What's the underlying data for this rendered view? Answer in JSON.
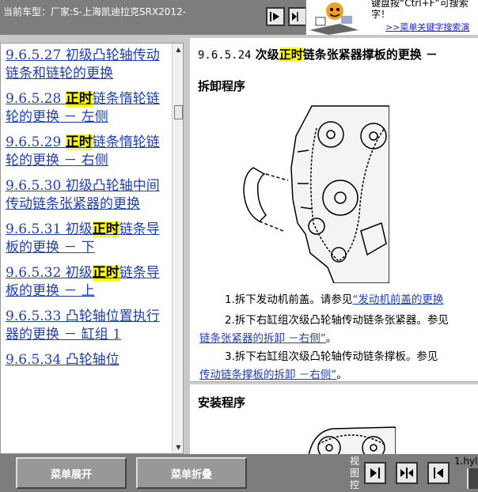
{
  "header": {
    "vehicle_label": "当前车型：厂家:S-上海凯迪拉克SRX2012-",
    "ad": {
      "text": "键盘按“Ctrl+F”可搜索 字！",
      "link": ">>菜单关键字搜索演"
    }
  },
  "menu": {
    "items": [
      {
        "num": "9.6.5.27",
        "pre": " 初级凸轮轴传动链条和链轮的更换",
        "hl": "",
        "post": ""
      },
      {
        "num": "9.6.5.28",
        "pre": " ",
        "hl": "正时",
        "post": "链条惰轮链轮的更换 － 左侧"
      },
      {
        "num": "9.6.5.29",
        "pre": " ",
        "hl": "正时",
        "post": "链条惰轮链轮的更换 － 右侧"
      },
      {
        "num": "9.6.5.30",
        "pre": " 初级凸轮轴中间传动链条张紧器的更换",
        "hl": "",
        "post": ""
      },
      {
        "num": "9.6.5.31",
        "pre": " 初级",
        "hl": "正时",
        "post": "链条导板的更换 － 下"
      },
      {
        "num": "9.6.5.32",
        "pre": " 初级",
        "hl": "正时",
        "post": "链条导板的更换 － 上"
      },
      {
        "num": "9.6.5.33",
        "pre": " 凸轮轴位置执行器的更换 － 缸组 1",
        "hl": "",
        "post": ""
      },
      {
        "num": "9.6.5.34",
        "pre": " 凸轮轴位",
        "hl": "",
        "post": ""
      }
    ]
  },
  "content": {
    "title_num": "9.6.5.24",
    "title_pre": "次级",
    "title_hl": "正时",
    "title_post": "链条张紧器撑板的更换 －",
    "removal_heading": "拆卸程序",
    "install_heading": "安装程序",
    "steps": [
      {
        "text": "1.拆下发动机前盖。请参见",
        "link": "“发动机前盖的更换",
        "tail": ""
      },
      {
        "text": "2.拆下右缸组次级凸轮轴传动链条张紧器。参见",
        "link": "链条张紧器的拆卸 －右侧”",
        "tail": "。"
      },
      {
        "text": "3.拆下右缸组次级凸轮轴传动链条撑板。参见",
        "link": "传动链条撑板的拆卸 －右侧”",
        "tail": "。"
      }
    ]
  },
  "footer": {
    "expand_label": "菜单展开",
    "collapse_label": "菜单折叠",
    "view_label": "视图控",
    "filename": "1.hyl"
  }
}
